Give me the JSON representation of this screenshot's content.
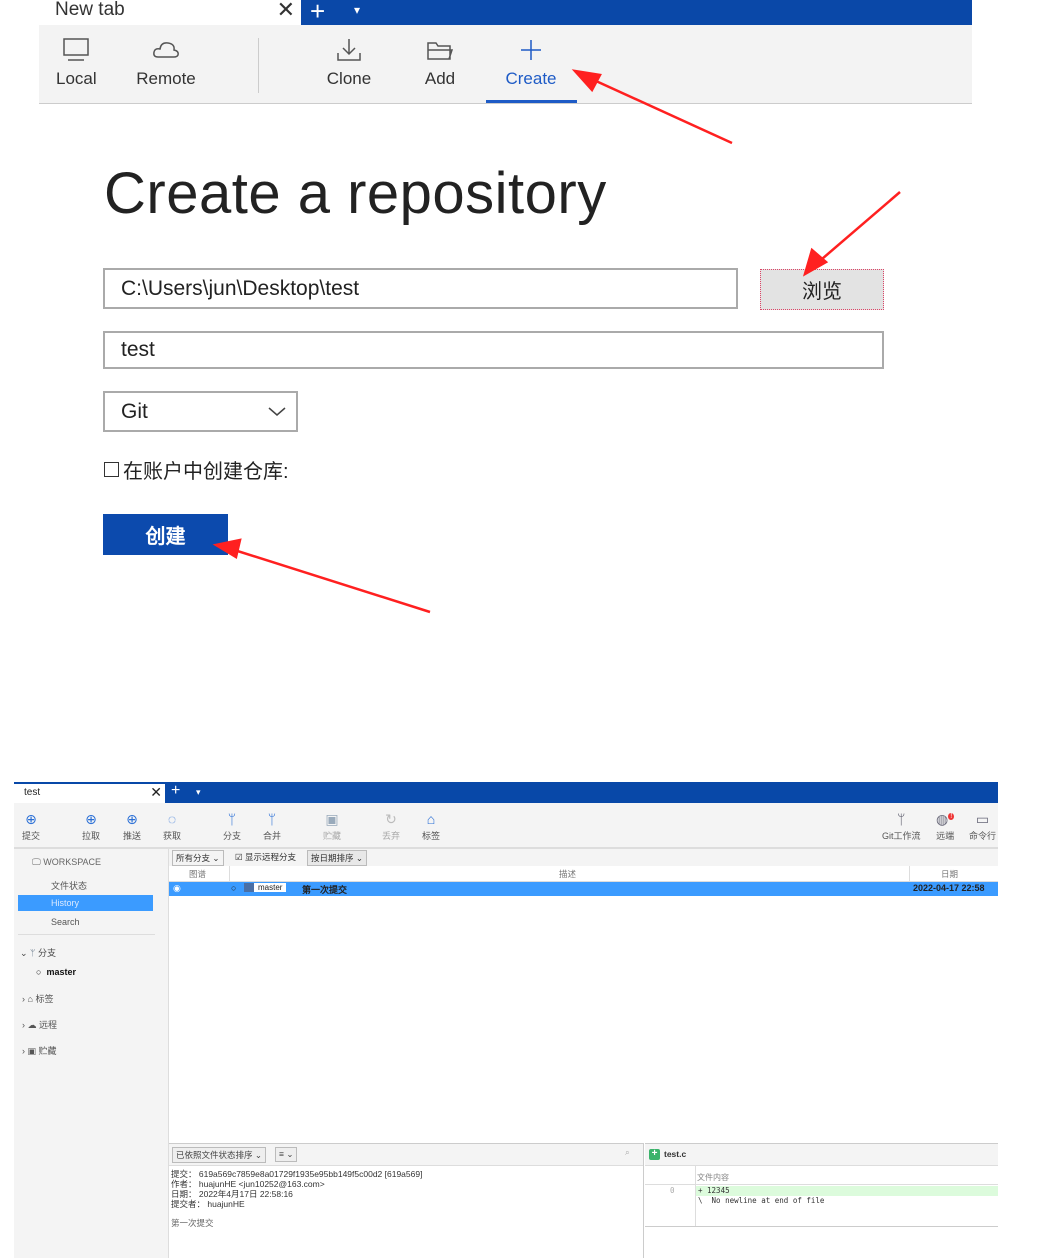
{
  "top_window": {
    "tab": {
      "title": "New tab",
      "close": "✕",
      "new": "+",
      "dropdown": "▾"
    },
    "toolbar": [
      {
        "label": "Local",
        "icon": "monitor-icon"
      },
      {
        "label": "Remote",
        "icon": "cloud-icon"
      },
      {
        "label": "Clone",
        "icon": "download-icon"
      },
      {
        "label": "Add",
        "icon": "folder-icon"
      },
      {
        "label": "Create",
        "icon": "plus-icon",
        "active": true
      }
    ],
    "title": "Create a repository",
    "path_value": "C:\\Users\\jun\\Desktop\\test",
    "browse_label": "浏览",
    "name_value": "test",
    "type_value": "Git",
    "checkbox_label": "在账户中创建仓库:",
    "create_label": "创建",
    "accent": "#0c4aad",
    "arrow_color": "#ff2020"
  },
  "app": {
    "tab": {
      "title": "test",
      "close": "✕",
      "new": "+",
      "dropdown": "▾"
    },
    "toolbar": [
      {
        "label": "提交"
      },
      {
        "label": "拉取"
      },
      {
        "label": "推送"
      },
      {
        "label": "获取"
      },
      {
        "label": "分支"
      },
      {
        "label": "合并"
      },
      {
        "label": "贮藏"
      },
      {
        "label": "丢弃"
      },
      {
        "label": "标签"
      }
    ],
    "toolbar_right": [
      {
        "label": "Git工作流"
      },
      {
        "label": "远端",
        "badge": "!"
      },
      {
        "label": "命令行"
      }
    ],
    "sidebar": {
      "workspace": "WORKSPACE",
      "items": [
        "文件状态",
        "History",
        "Search"
      ],
      "branches": "分支",
      "branch_master": "master",
      "tags": "标签",
      "remotes": "远程",
      "stashes": "贮藏"
    },
    "filters": {
      "branches": "所有分支",
      "show_remote": "显示远程分支",
      "sort": "按日期排序"
    },
    "columns": {
      "graph": "图谱",
      "desc": "描述",
      "date": "日期"
    },
    "commit_row": {
      "branch": "master",
      "message": "第一次提交",
      "date": "2022-04-17 22:58"
    },
    "details": {
      "sort": "已依照文件状态排序",
      "view": "≡",
      "lines": [
        "提交： 619a569c7859e8a01729f1935e95bb149f5c00d2 [619a569]",
        "作者： huajunHE <jun10252@163.com>",
        "日期： 2022年4月17日 22:58:16",
        "提交者： huajunHE"
      ],
      "message": "第一次提交"
    },
    "diff": {
      "file": "test.c",
      "header": "文件内容",
      "line_no": "0",
      "lines": [
        "+ 12345",
        "\\  No newline at end of file"
      ]
    },
    "highlight": "#3b9bff"
  }
}
